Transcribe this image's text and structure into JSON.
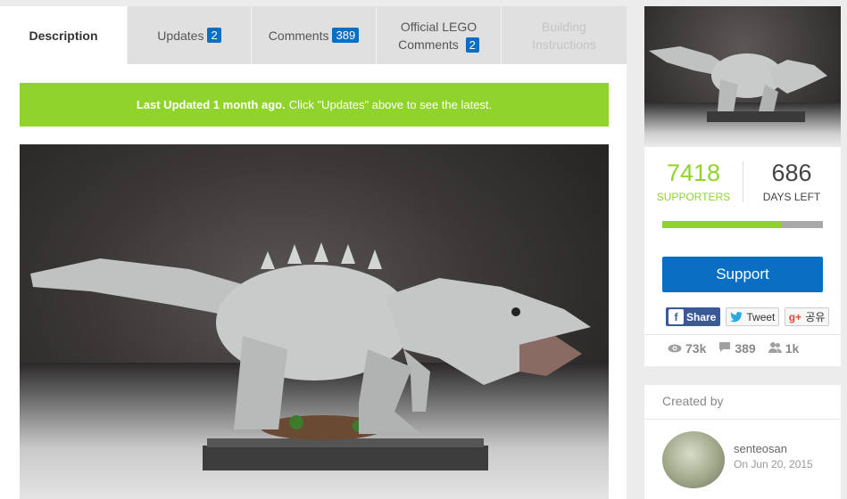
{
  "tabs": [
    {
      "label": "Description",
      "badge": ""
    },
    {
      "label": "Updates",
      "badge": "2"
    },
    {
      "label": "Comments",
      "badge": "389"
    },
    {
      "label": "Official LEGO Comments",
      "badge": "2"
    },
    {
      "label": "Building Instructions",
      "badge": ""
    }
  ],
  "banner": {
    "bold": "Last Updated 1 month ago.",
    "text": "Click \"Updates\" above to see the latest."
  },
  "stats": {
    "supporters": "7418",
    "supporters_label": "SUPPORTERS",
    "days": "686",
    "days_label": "DAYS LEFT",
    "progress_fraction": 0.74
  },
  "support_button": "Support",
  "share": {
    "facebook": "Share",
    "twitter": "Tweet",
    "google": "공유"
  },
  "meta": {
    "views": "73k",
    "comments": "389",
    "followers": "1k"
  },
  "creator": {
    "title": "Created by",
    "name": "senteosan",
    "date": "On Jun 20, 2015"
  },
  "colors": {
    "accent_green": "#8fd32b",
    "brand_blue": "#0a6fc2"
  }
}
